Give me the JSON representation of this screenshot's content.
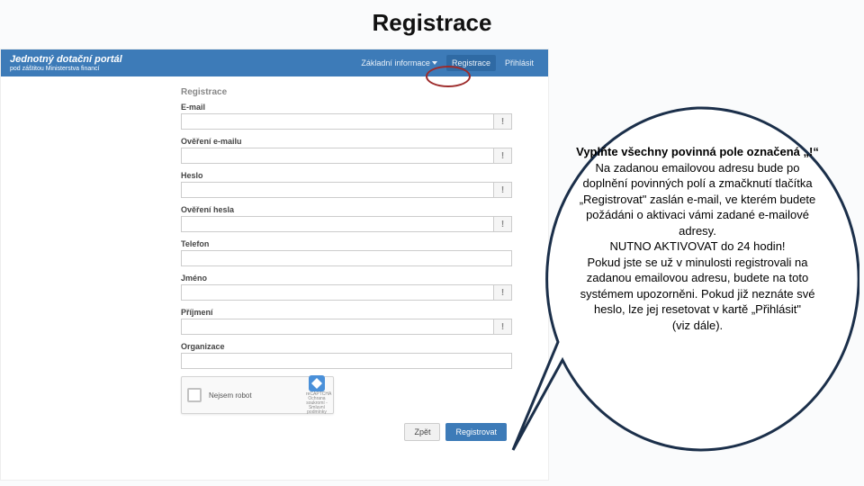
{
  "slide": {
    "title": "Registrace"
  },
  "topbar": {
    "brand_title": "Jednotný dotační portál",
    "brand_sub": "pod záštitou Ministerstva financí",
    "nav_info": "Základní informace",
    "nav_register": "Registrace",
    "nav_login": "Přihlásit"
  },
  "form": {
    "panel_title": "Registrace",
    "email": "E-mail",
    "email_confirm": "Ověření e-mailu",
    "password": "Heslo",
    "password_confirm": "Ověření hesla",
    "phone": "Telefon",
    "firstname": "Jméno",
    "lastname": "Příjmení",
    "organization": "Organizace",
    "help_glyph": "!"
  },
  "captcha": {
    "label": "Nejsem robot",
    "brand": "reCAPTCHA",
    "sub": "Ochrana soukromí - Smluvní podmínky"
  },
  "buttons": {
    "back": "Zpět",
    "register": "Registrovat"
  },
  "bubble": {
    "line1": "Vyplňte všechny povinná pole označená „!“",
    "line2": "Na zadanou emailovou adresu bude po doplnění povinných polí a zmačknutí tlačítka „Registrovat\" zaslán e-mail, ve kterém budete požádáni o aktivaci vámi zadané e-mailové adresy.",
    "line3": "NUTNO AKTIVOVAT do 24 hodin!",
    "line4": "Pokud jste se už v minulosti registrovali na zadanou emailovou adresu, budete na toto systémem upozorněni. Pokud již neznáte své heslo, lze jej resetovat v kartě „Přihlásit\"",
    "line5": "(viz dále)."
  }
}
